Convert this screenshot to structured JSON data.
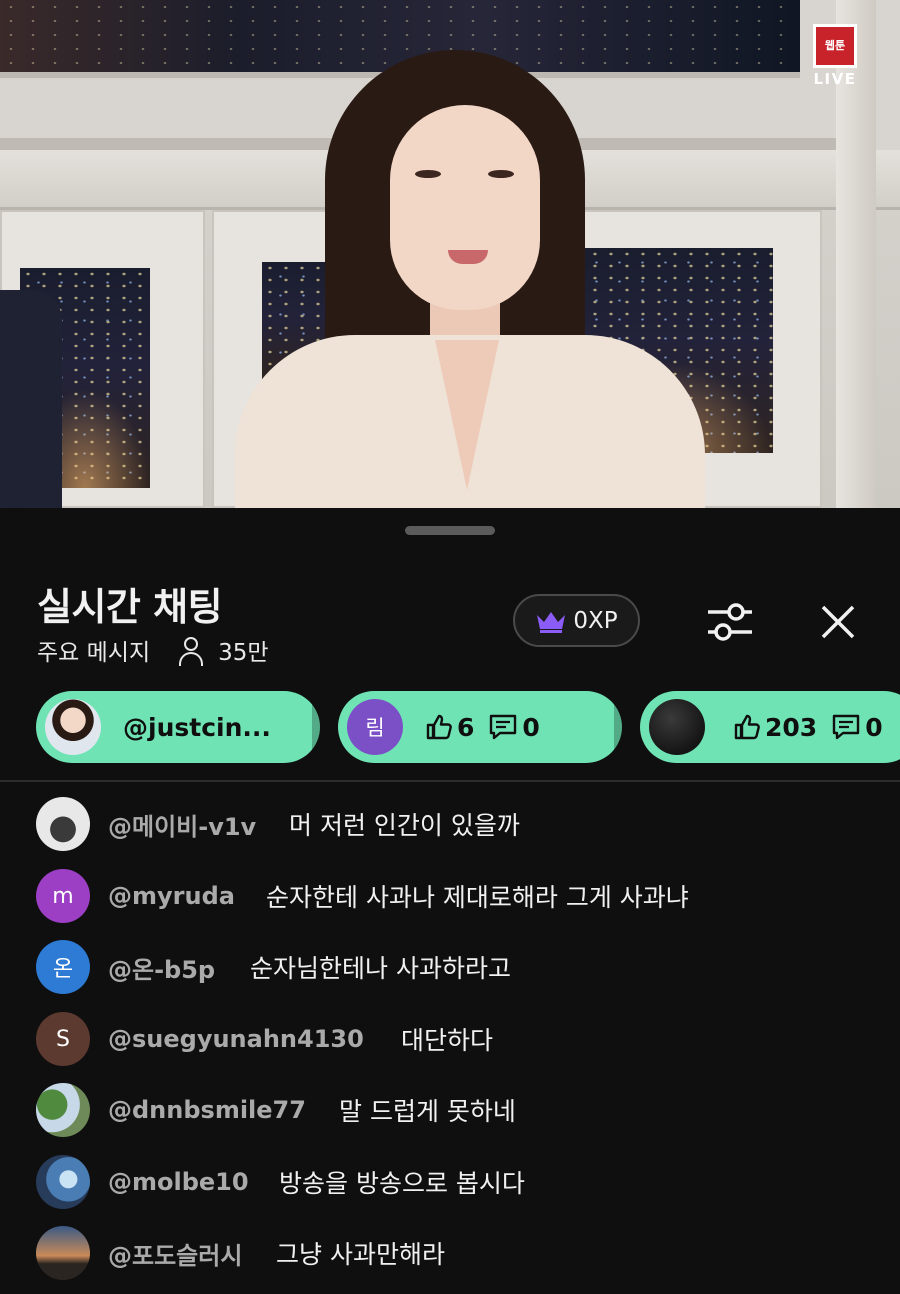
{
  "video": {
    "channel_logo_text": "웹툰",
    "live_label": "LIVE"
  },
  "chat": {
    "title": "실시간 채팅",
    "mode": "주요 메시지",
    "viewer_count": "35만",
    "xp": "0XP",
    "filter_icon": "sliders-icon",
    "close_icon": "close-icon"
  },
  "pinned": [
    {
      "handle": "@justcin...",
      "avatar_type": "photo"
    },
    {
      "avatar_letter": "림",
      "avatar_color": "#7b50c7",
      "likes": "6",
      "replies": "0"
    },
    {
      "avatar_type": "photo-dark",
      "likes": "203",
      "replies": "0"
    }
  ],
  "messages": [
    {
      "author": "@메이비-v1v",
      "text": "머 저런 인간이 있을까",
      "avatar": "",
      "avatar_color": "#e8e8e8"
    },
    {
      "author": "@myruda",
      "text": "순자한테 사과나 제대로해라 그게 사과냐",
      "avatar": "m",
      "avatar_color": "#9c3fc4"
    },
    {
      "author": "@온-b5p",
      "text": "순자님한테나 사과하라고",
      "avatar": "온",
      "avatar_color": "#2d7bd4"
    },
    {
      "author": "@suegyunahn4130",
      "text": "대단하다",
      "avatar": "S",
      "avatar_color": "#5d3a30"
    },
    {
      "author": "@dnnbsmile77",
      "text": "말 드럽게 못하네",
      "avatar": "",
      "avatar_color": "#6a8a5a"
    },
    {
      "author": "@molbe10",
      "text": "방송을 방송으로 봅시다",
      "avatar": "",
      "avatar_color": "#3b6fa8"
    },
    {
      "author": "@포도슬러시",
      "text": "그냥 사과만해라",
      "avatar": "",
      "avatar_color": "#c4825a"
    }
  ],
  "colors": {
    "accent_chip": "#6fe3b4",
    "background": "#0f0f0f",
    "crown": "#8b5cf6"
  }
}
